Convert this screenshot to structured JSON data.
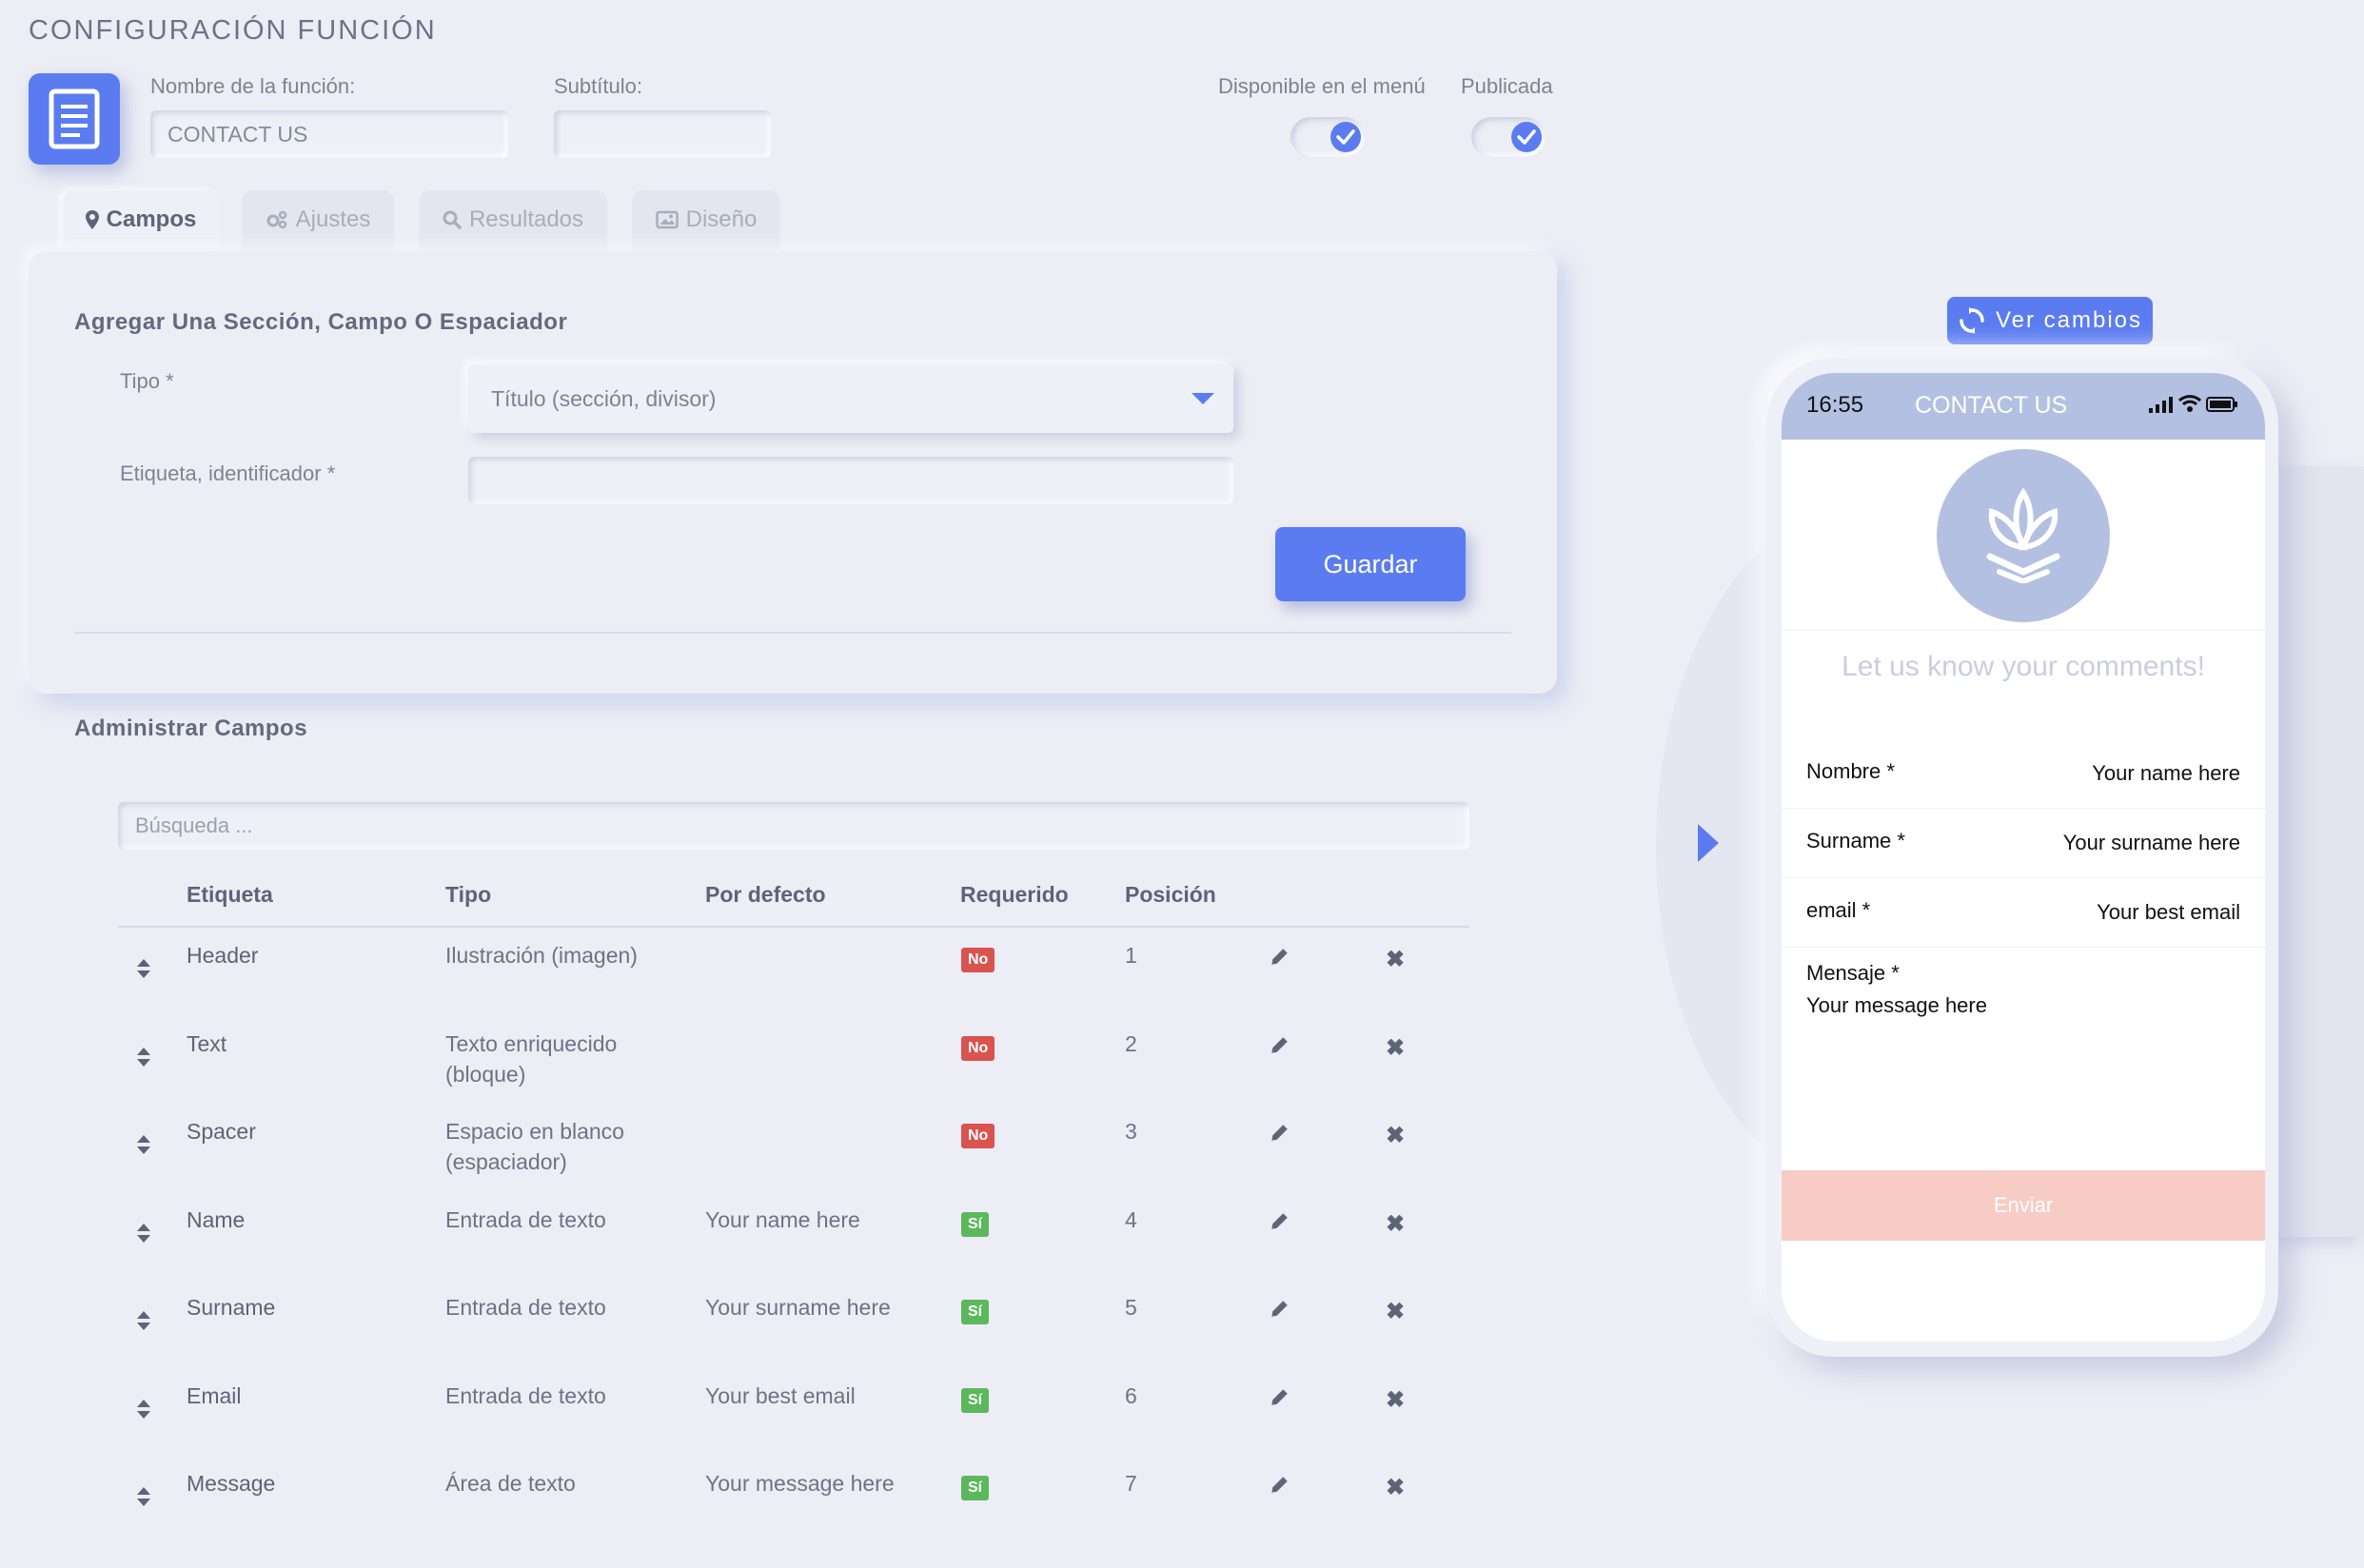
{
  "page": {
    "title": "CONFIGURACIÓN FUNCIÓN"
  },
  "function_config": {
    "name_label": "Nombre de la función:",
    "name_value": "CONTACT US",
    "subtitle_label": "Subtítulo:",
    "subtitle_value": "",
    "menu_available_label": "Disponible en el menú",
    "menu_available_checked": true,
    "published_label": "Publicada",
    "published_checked": true
  },
  "tabs": [
    {
      "label": "Campos",
      "icon": "map-marker-icon",
      "active": true
    },
    {
      "label": "Ajustes",
      "icon": "gears-icon",
      "active": false
    },
    {
      "label": "Resultados",
      "icon": "search-icon",
      "active": false
    },
    {
      "label": "Diseño",
      "icon": "image-icon",
      "active": false
    }
  ],
  "add_section": {
    "title": "Agregar Una Sección, Campo O Espaciador",
    "type_label": "Tipo *",
    "type_value": "Título (sección, divisor)",
    "tag_label": "Etiqueta, identificador *",
    "tag_value": "",
    "save_label": "Guardar"
  },
  "manage": {
    "title": "Administrar Campos",
    "search_placeholder": "Búsqueda ...",
    "columns": [
      "Etiqueta",
      "Tipo",
      "Por defecto",
      "Requerido",
      "Posición"
    ],
    "rows": [
      {
        "label": "Header",
        "type": "Ilustración (imagen)",
        "default": "",
        "required": "No",
        "position": "1"
      },
      {
        "label": "Text",
        "type": "Texto enriquecido (bloque)",
        "default": "",
        "required": "No",
        "position": "2"
      },
      {
        "label": "Spacer",
        "type": "Espacio en blanco (espaciador)",
        "default": "",
        "required": "No",
        "position": "3"
      },
      {
        "label": "Name",
        "type": "Entrada de texto",
        "default": "Your name here",
        "required": "Sí",
        "position": "4"
      },
      {
        "label": "Surname",
        "type": "Entrada de texto",
        "default": "Your surname here",
        "required": "Sí",
        "position": "5"
      },
      {
        "label": "Email",
        "type": "Entrada de texto",
        "default": "Your best email",
        "required": "Sí",
        "position": "6"
      },
      {
        "label": "Message",
        "type": "Área de texto",
        "default": "Your message here",
        "required": "Sí",
        "position": "7"
      }
    ]
  },
  "preview": {
    "button_label": "Ver cambios",
    "time": "16:55",
    "title": "CONTACT US",
    "subtitle": "Let us know your comments!",
    "fields": [
      {
        "label": "Nombre *",
        "placeholder": "Your name here"
      },
      {
        "label": "Surname *",
        "placeholder": "Your surname here"
      },
      {
        "label": "email *",
        "placeholder": "Your best email"
      }
    ],
    "message_label": "Mensaje *",
    "message_placeholder": "Your message here",
    "submit_label": "Enviar"
  },
  "colors": {
    "accent": "#5b7cf0",
    "background": "#ecedf5",
    "badge_no": "#d9534f",
    "badge_yes": "#5cb85c",
    "submit": "#f7ccc4",
    "phone_bar": "#b4c0e2"
  }
}
